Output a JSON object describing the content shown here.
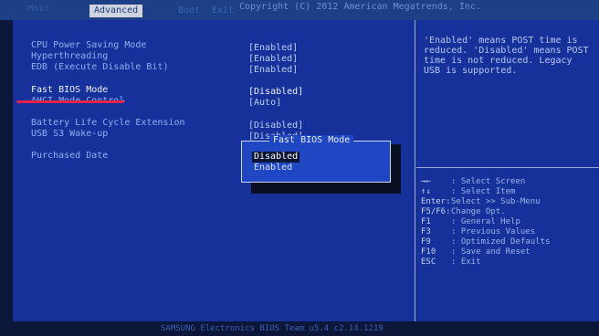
{
  "header": {
    "tab_left": "Main",
    "active_tab": "Advanced",
    "tab_boot": "Boot",
    "tab_exit": "Exit",
    "copyright": "Copyright (C) 2012 American Megatrends, Inc."
  },
  "settings": [
    {
      "label": "CPU Power Saving Mode",
      "value": "[Enabled]"
    },
    {
      "label": "Hyperthreading",
      "value": "[Enabled]"
    },
    {
      "label": "EDB (Execute Disable Bit)",
      "value": "[Enabled]"
    },
    {
      "label": "Fast BIOS Mode",
      "value": "[Disabled]"
    },
    {
      "label": "AHCI Mode Control",
      "value": "[Auto]"
    },
    {
      "label": "Battery Life Cycle Extension",
      "value": "[Disabled]"
    },
    {
      "label": "USB S3 Wake-up",
      "value": "[Disabled]"
    },
    {
      "label": "Purchased Date",
      "value": ""
    }
  ],
  "help_text": [
    "'Enabled' means POST time is",
    "reduced. 'Disabled' means POST",
    "time is not reduced. Legacy",
    "USB is supported."
  ],
  "keys": [
    {
      "key": "→←",
      "desc": ": Select Screen"
    },
    {
      "key": "↑↓",
      "desc": ": Select Item"
    },
    {
      "key": "Enter:",
      "desc": "Select >> Sub-Menu"
    },
    {
      "key": "F5/F6:",
      "desc": "Change Opt."
    },
    {
      "key": "F1",
      "desc": ": General Help"
    },
    {
      "key": "F3",
      "desc": ": Previous Values"
    },
    {
      "key": "F9",
      "desc": ": Optimized Defaults"
    },
    {
      "key": "F10",
      "desc": ": Save and Reset"
    },
    {
      "key": "ESC",
      "desc": ": Exit"
    }
  ],
  "popup": {
    "title": "Fast BIOS Mode",
    "options": [
      "Disabled",
      "Enabled"
    ],
    "selected": "Disabled"
  },
  "footer": "SAMSUNG Electronics BIOS Team u5.4  c2.14.1219",
  "colors": {
    "screen_bg": "#16329a",
    "popup_bg": "#1f47c4",
    "highlight_underline": "#e5244a"
  }
}
